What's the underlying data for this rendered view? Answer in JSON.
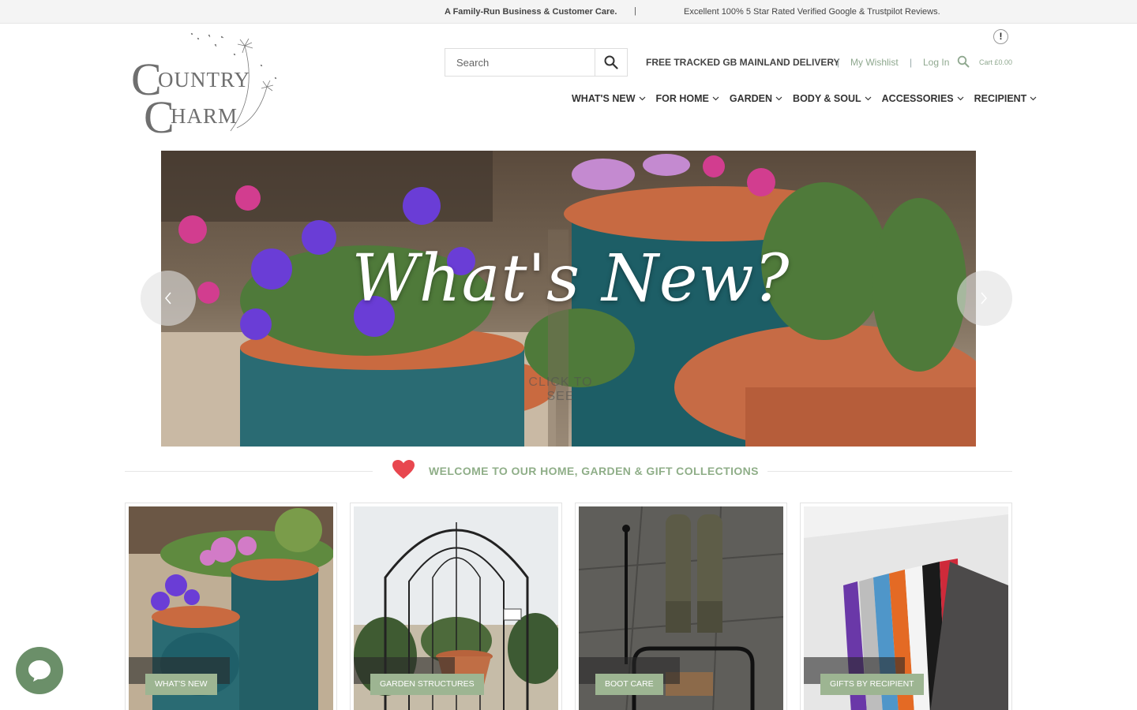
{
  "announcement": {
    "message_1": "A Family-Run Business & Customer Care.",
    "separator": "|",
    "message_2": "Excellent 100% 5 Star Rated Verified Google & Trustpilot Reviews."
  },
  "brand": {
    "logo_line_1_initial": "C",
    "logo_line_1_rest": "OUNTRY",
    "logo_line_2_initial": "C",
    "logo_line_2_rest": "HARM"
  },
  "alert_badge": "!",
  "search": {
    "placeholder": "Search",
    "button_icon": "search-icon"
  },
  "utility": {
    "delivery": "FREE TRACKED GB MAINLAND DELIVERY",
    "separator": "|",
    "wishlist": "My Wishlist",
    "login": "Log In",
    "cart": "Cart £0.00"
  },
  "nav": {
    "items": [
      {
        "label": "WHAT'S NEW"
      },
      {
        "label": "FOR HOME"
      },
      {
        "label": "GARDEN"
      },
      {
        "label": "BODY & SOUL"
      },
      {
        "label": "ACCESSORIES"
      },
      {
        "label": "RECIPIENT"
      }
    ]
  },
  "hero": {
    "title": "What's New?",
    "cta": "CLICK TO SEE",
    "prev_icon": "chevron-left-icon",
    "next_icon": "chevron-right-icon"
  },
  "welcome": {
    "icon": "heart-icon",
    "text": "WELCOME TO OUR HOME, GARDEN & GIFT COLLECTIONS"
  },
  "categories": [
    {
      "label": "WHAT'S NEW"
    },
    {
      "label": "GARDEN STRUCTURES"
    },
    {
      "label": "BOOT CARE"
    },
    {
      "label": "GIFTS BY RECIPIENT"
    }
  ],
  "colors": {
    "accent_green": "#8fae88",
    "label_green": "#9db592",
    "chat_green": "#6b8f69",
    "heart_red": "#e8474f"
  },
  "chat": {
    "icon": "chat-bubble-icon"
  }
}
